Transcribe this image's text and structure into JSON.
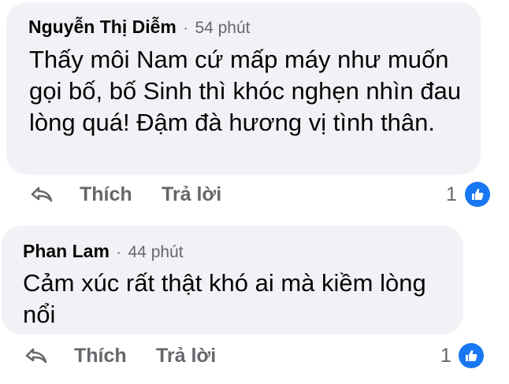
{
  "comments": [
    {
      "author": "Nguyễn Thị Diễm",
      "separator": "·",
      "time": "54 phút",
      "text": "Thấy môi Nam cứ mấp máy như muốn gọi bố, bố Sinh thì khóc nghẹn nhìn đau lòng quá! Đậm đà hương vị tình thân.",
      "like_label": "Thích",
      "reply_label": "Trả lời",
      "reaction_count": "1",
      "reaction_icon": "like-icon"
    },
    {
      "author": "Phan Lam",
      "separator": "·",
      "time": "44 phút",
      "text": "Cảm xúc rất thật khó ai mà kiềm lòng nổi",
      "like_label": "Thích",
      "reply_label": "Trả lời",
      "reaction_count": "1",
      "reaction_icon": "like-icon"
    }
  ],
  "colors": {
    "bubble_bg": "#f0f2f5",
    "secondary_text": "#65676b",
    "primary_text": "#050505",
    "like_blue": "#1877f2"
  }
}
